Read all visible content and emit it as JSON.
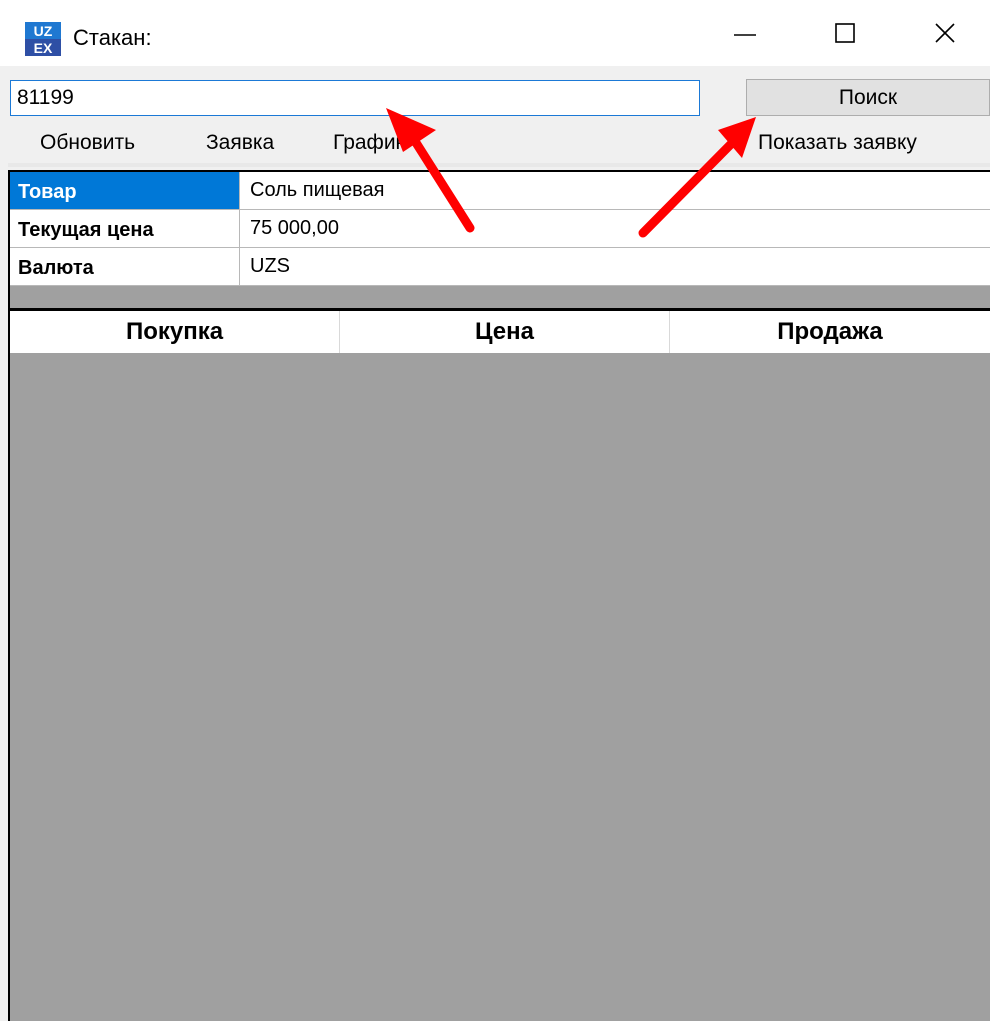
{
  "window": {
    "title": "Стакан:",
    "icon": "uzex-logo-icon",
    "icon_text_top": "UZ",
    "icon_text_bottom": "EX",
    "controls": [
      "minimize-icon",
      "maximize-icon",
      "close-icon"
    ]
  },
  "search": {
    "value": "81199",
    "button_label": "Поиск"
  },
  "menu": {
    "update": "Обновить",
    "order": "Заявка",
    "chart": "График",
    "show_order": "Показать заявку"
  },
  "info": {
    "rows": [
      {
        "label": "Товар",
        "value": "Соль пищевая"
      },
      {
        "label": "Текущая цена",
        "value": "75 000,00"
      },
      {
        "label": "Валюта",
        "value": "UZS"
      }
    ]
  },
  "order_book": {
    "columns": [
      "Покупка",
      "Цена",
      "Продажа"
    ]
  },
  "annotations": {
    "arrow_color": "#ff0000",
    "arrows": [
      "arrow-to-search-input",
      "arrow-to-search-button"
    ]
  },
  "colors": {
    "selection": "#0078d7",
    "grid_background": "#a0a0a0",
    "input_border": "#1b79d6"
  }
}
